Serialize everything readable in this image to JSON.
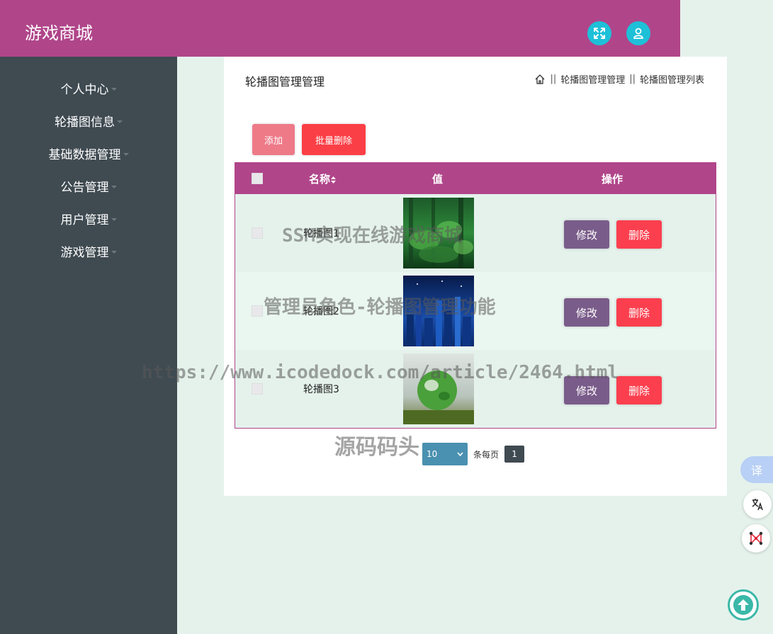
{
  "header": {
    "brand": "游戏商城"
  },
  "sidebar": {
    "items": [
      {
        "label": "个人中心"
      },
      {
        "label": "轮播图信息"
      },
      {
        "label": "基础数据管理"
      },
      {
        "label": "公告管理"
      },
      {
        "label": "用户管理"
      },
      {
        "label": "游戏管理"
      }
    ]
  },
  "panel": {
    "title": "轮播图管理管理",
    "breadcrumb": {
      "sep": "||",
      "level1": "轮播图管理管理",
      "level2": "轮播图管理列表"
    }
  },
  "toolbar": {
    "add_label": "添加",
    "batch_delete_label": "批量删除"
  },
  "table": {
    "columns": {
      "name": "名称",
      "value": "值",
      "actions": "操作"
    },
    "rows": [
      {
        "name": "轮播图1",
        "edit": "修改",
        "delete": "删除"
      },
      {
        "name": "轮播图2",
        "edit": "修改",
        "delete": "删除"
      },
      {
        "name": "轮播图3",
        "edit": "修改",
        "delete": "删除"
      }
    ]
  },
  "pagination": {
    "page_size": "10",
    "per_page_label": "条每页",
    "current_page": "1"
  },
  "watermarks": {
    "line1": "SSM实现在线游戏商城",
    "line2": "管理员角色-轮播图管理功能",
    "line3": "https://www.icodedock.com/article/2464.html",
    "line4": "源码码头"
  },
  "floating": {
    "translate_label": "译"
  },
  "colors": {
    "primary": "#b0458a",
    "sidebar": "#3f4a51",
    "background": "#e5f2ec",
    "accent_cyan": "#1ec0d8",
    "danger": "#fb3f46",
    "edit": "#7a5c8a"
  }
}
